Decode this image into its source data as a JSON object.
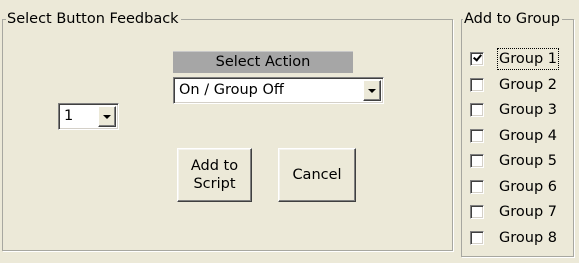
{
  "feedback_panel": {
    "title": "Select Button Feedback",
    "select_action_header": "Select Action",
    "action_dropdown": {
      "value": "On / Group Off"
    },
    "number_dropdown": {
      "value": "1"
    },
    "add_button_label": "Add to\nScript",
    "cancel_button_label": "Cancel"
  },
  "group_panel": {
    "title": "Add to Group",
    "groups": [
      {
        "label": "Group 1",
        "checked": true,
        "focused": true
      },
      {
        "label": "Group 2",
        "checked": false
      },
      {
        "label": "Group 3",
        "checked": false
      },
      {
        "label": "Group 4",
        "checked": false
      },
      {
        "label": "Group 5",
        "checked": false
      },
      {
        "label": "Group 6",
        "checked": false
      },
      {
        "label": "Group 7",
        "checked": false
      },
      {
        "label": "Group 8",
        "checked": false
      }
    ]
  }
}
